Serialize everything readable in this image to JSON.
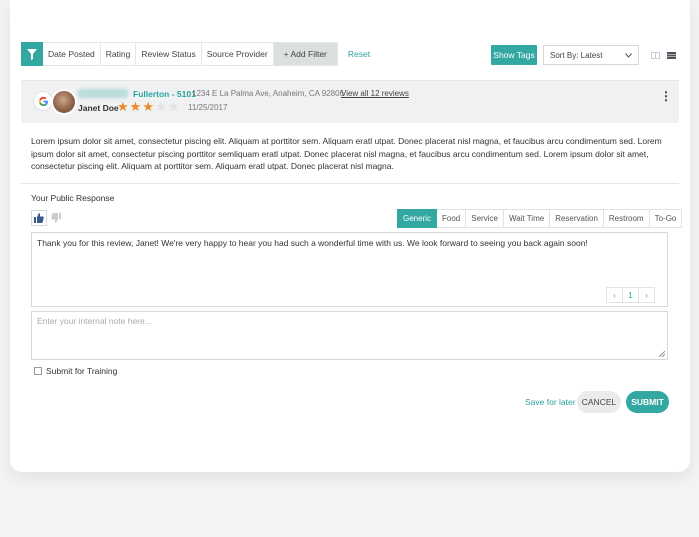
{
  "filters": {
    "items": [
      "Date Posted",
      "Rating",
      "Review Status",
      "Source Provider"
    ],
    "add_label": "+ Add Filter",
    "reset_label": "Reset"
  },
  "toolbar": {
    "show_tags_label": "Show Tags",
    "sort_value": "Sort By: Latest"
  },
  "review": {
    "business_name": "Fullerton - 5101",
    "address": "1234 E La Palma Ave, Anaheim, CA 92806",
    "view_all_label": "View all 12 reviews",
    "reviewer_name": "Janet Doe",
    "rating": 3,
    "max_rating": 5,
    "date": "11/25/2017",
    "body_lines": [
      "Lorem ipsum dolor sit amet, consectetur piscing elit. Aliquam at porttitor sem.  Aliquam eratl utpat. Donec placerat nisl magna, et faucibus arcu condimentum sed. Lorem",
      "ipsum dolor sit amet, consectetur piscing porttitor semliquam eratl utpat. Donec placerat nisl magna, et faucibus arcu condimentum sed. Lorem ipsum dolor sit amet,",
      "consectetur piscing elit. Aliquam at porttitor sem.  Aliquam eratl utpat. Donec placerat nisl magna."
    ]
  },
  "response": {
    "label": "Your Public Response",
    "tabs": [
      "Generic",
      "Food",
      "Service",
      "Wait Time",
      "Reservation",
      "Restroom",
      "To-Go"
    ],
    "text": "Thank you for this review, Janet! We're very happy to hear you had such a wonderful time with us. We look forward to seeing you back again soon!",
    "page": "1",
    "prev_glyph": "‹",
    "next_glyph": "›",
    "note_placeholder": "Enter your internal note here...",
    "training_label": "Submit for Training"
  },
  "actions": {
    "save_later": "Save for later",
    "cancel": "CANCEL",
    "submit": "SUBMIT"
  },
  "colors": {
    "accent": "#33a8a3",
    "star": "#f08a24"
  }
}
